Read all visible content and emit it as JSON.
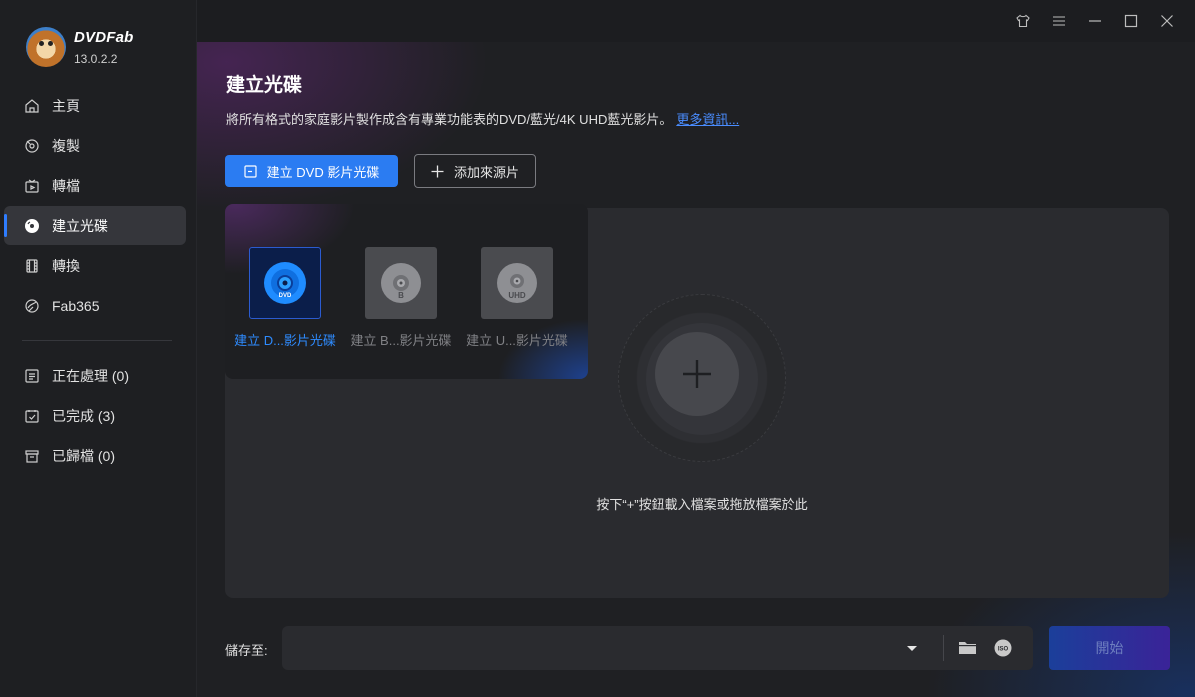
{
  "app": {
    "name": "DVDFab",
    "version": "13.0.2.2"
  },
  "sidebar": {
    "items": [
      {
        "label": "主頁",
        "icon": "home-icon"
      },
      {
        "label": "複製",
        "icon": "copy-icon"
      },
      {
        "label": "轉檔",
        "icon": "ripper-icon"
      },
      {
        "label": "建立光碟",
        "icon": "disc-icon",
        "active": true
      },
      {
        "label": "轉換",
        "icon": "film-icon"
      },
      {
        "label": "Fab365",
        "icon": "fab365-icon"
      }
    ],
    "tasks": [
      {
        "label": "正在處理 (0)",
        "icon": "processing-icon"
      },
      {
        "label": "已完成 (3)",
        "icon": "completed-icon"
      },
      {
        "label": "已歸檔 (0)",
        "icon": "archive-icon"
      }
    ]
  },
  "main": {
    "title": "建立光碟",
    "description": "將所有格式的家庭影片製作成含有專業功能表的DVD/藍光/4K UHD藍光影片。",
    "more_link": "更多資訊...",
    "create_button": "建立 DVD 影片光碟",
    "add_source_button": "添加來源片",
    "disc_types": [
      {
        "label": "建立 D...影片光碟",
        "icon": "dvd-disc-icon",
        "selected": true
      },
      {
        "label": "建立 B...影片光碟",
        "icon": "bluray-disc-icon",
        "selected": false
      },
      {
        "label": "建立 U...影片光碟",
        "icon": "uhd-disc-icon",
        "selected": false
      }
    ],
    "drop_hint": "按下“+”按鈕載入檔案或拖放檔案於此",
    "save_to_label": "儲存至:",
    "save_to_value": "",
    "start_button": "開始"
  },
  "colors": {
    "accent": "#2b7cf2",
    "link": "#4a8dff",
    "background": "#1f2023",
    "sidebar": "#1e1f22"
  }
}
